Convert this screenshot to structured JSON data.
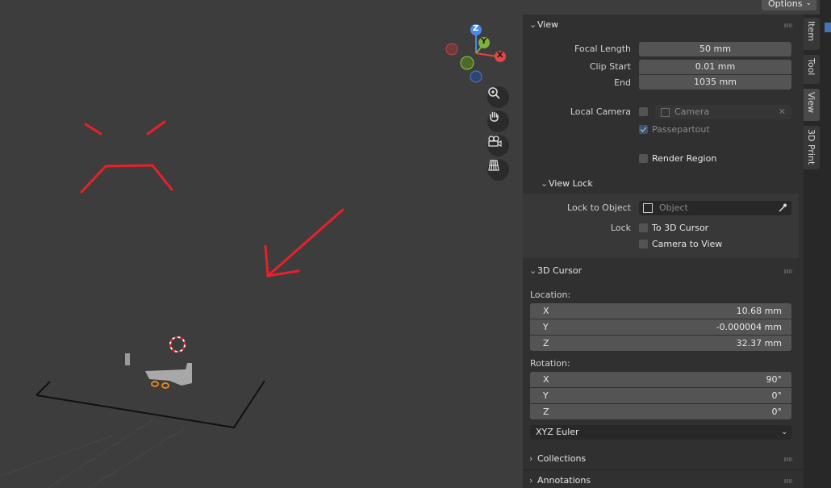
{
  "header": {
    "options_label": "Options"
  },
  "tabs": [
    {
      "label": "Item",
      "active": false
    },
    {
      "label": "Tool",
      "active": false
    },
    {
      "label": "View",
      "active": true
    },
    {
      "label": "3D Print",
      "active": false
    }
  ],
  "gizmo": {
    "z": "Z",
    "y": "Y",
    "x": "X"
  },
  "view_panel": {
    "title": "View",
    "focal_length_label": "Focal Length",
    "focal_length_value": "50 mm",
    "clip_start_label": "Clip Start",
    "clip_start_value": "0.01 mm",
    "end_label": "End",
    "end_value": "1035 mm",
    "local_camera_label": "Local Camera",
    "local_camera_placeholder": "Camera",
    "passepartout_label": "Passepartout",
    "render_region_label": "Render Region"
  },
  "view_lock": {
    "title": "View Lock",
    "lock_to_object_label": "Lock to Object",
    "object_placeholder": "Object",
    "lock_label": "Lock",
    "to_3d_cursor_label": "To 3D Cursor",
    "camera_to_view_label": "Camera to View"
  },
  "cursor_panel": {
    "title": "3D Cursor",
    "location_label": "Location:",
    "location": [
      {
        "axis": "X",
        "value": "10.68 mm"
      },
      {
        "axis": "Y",
        "value": "-0.000004 mm"
      },
      {
        "axis": "Z",
        "value": "32.37 mm"
      }
    ],
    "rotation_label": "Rotation:",
    "rotation": [
      {
        "axis": "X",
        "value": "90°"
      },
      {
        "axis": "Y",
        "value": "0°"
      },
      {
        "axis": "Z",
        "value": "0°"
      }
    ],
    "rotation_mode": "XYZ Euler"
  },
  "collapsed_panels": {
    "collections": "Collections",
    "annotations": "Annotations"
  },
  "colors": {
    "annotation_red": "#e8202a",
    "accent_blue": "#4772b3",
    "selection_orange": "#e8861a"
  }
}
